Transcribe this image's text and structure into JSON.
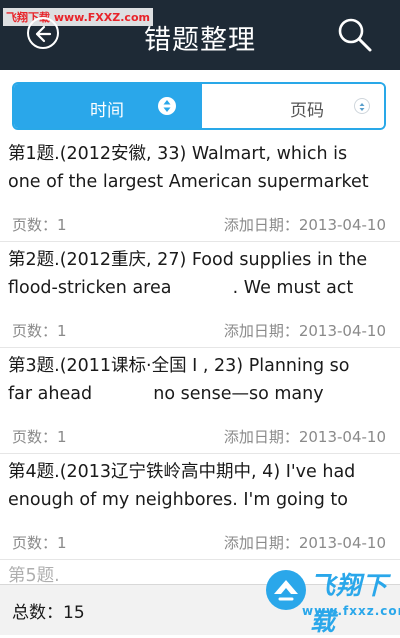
{
  "watermark_top": "飞翔下载 www.FXXZ.com",
  "header": {
    "title": "错题整理",
    "colors": {
      "bar": "#1e2a36",
      "accent": "#2aa7ea"
    }
  },
  "sort_tabs": [
    {
      "label": "时间",
      "selected": true,
      "icon": "sort-icon"
    },
    {
      "label": "页码",
      "selected": false,
      "icon": "sort-icon"
    }
  ],
  "questions": [
    {
      "line1": "第1题.(2012安徽, 33) Walmart, which is",
      "line2": "one of the largest American supermarket",
      "pages": "页数：1",
      "date": "添加日期：2013-04-10"
    },
    {
      "line1": "第2题.(2012重庆, 27) Food supplies in the",
      "line2": "flood-stricken area           . We must act",
      "pages": "页数：1",
      "date": "添加日期：2013-04-10"
    },
    {
      "line1": "第3题.(2011课标·全国 I , 23) Planning so",
      "line2": "far ahead           no sense—so many",
      "pages": "页数：1",
      "date": "添加日期：2013-04-10"
    },
    {
      "line1": "第4题.(2013辽宁铁岭高中期中, 4) I've had",
      "line2": "enough of my neighbores. I'm going to",
      "pages": "页数：1",
      "date": "添加日期：2013-04-10"
    },
    {
      "line1": "第5题.",
      "line2": "",
      "pages": "",
      "date": ""
    }
  ],
  "footer": {
    "total": "总数：15"
  },
  "brand_watermark": {
    "main": "飞翔下载",
    "url": "www.fxxz.com"
  }
}
